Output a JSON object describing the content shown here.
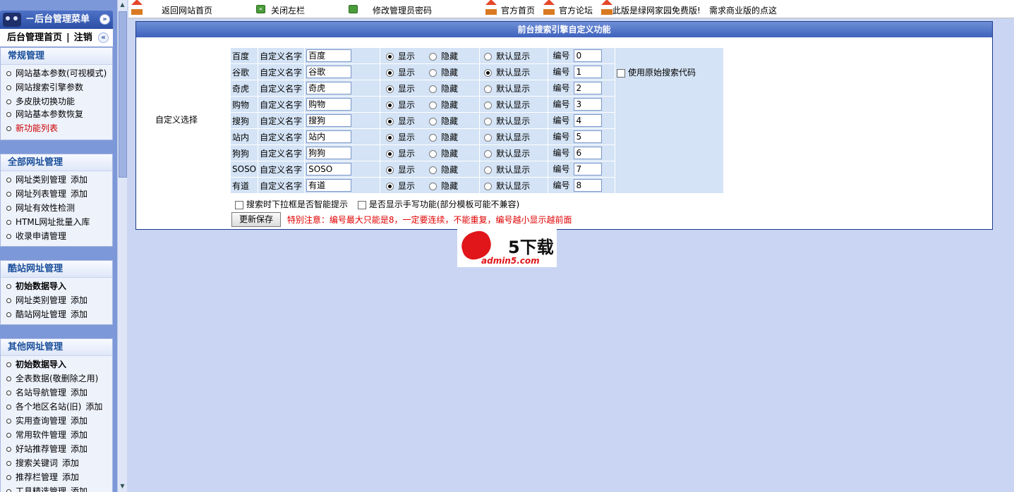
{
  "sidebar": {
    "header": "－后台管理菜单",
    "top_link": "后台管理首页",
    "top_sep": "|",
    "logout": "注销",
    "collapse_glyph": "«",
    "expand_glyph": "»",
    "sections": [
      {
        "title": "常规管理",
        "items": [
          {
            "label": "网站基本参数(可视模式)"
          },
          {
            "label": "网站搜索引擎参数"
          },
          {
            "label": "多皮肤切换功能"
          },
          {
            "label": "网站基本参数恢复"
          },
          {
            "label": "新功能列表"
          }
        ]
      },
      {
        "title": "全部网址管理",
        "items": [
          {
            "label": "网址类别管理",
            "add": "添加"
          },
          {
            "label": "网址列表管理",
            "add": "添加"
          },
          {
            "label": "网址有效性检测"
          },
          {
            "label": "HTML网址批量入库"
          },
          {
            "label": "收录申请管理"
          }
        ]
      },
      {
        "title": "酷站网址管理",
        "items": [
          {
            "label": "初始数据导入"
          },
          {
            "label": "网址类别管理",
            "add": "添加"
          },
          {
            "label": "酷站网址管理",
            "add": "添加"
          }
        ]
      },
      {
        "title": "其他网址管理",
        "items": [
          {
            "label": "初始数据导入"
          },
          {
            "label": "全表数据(敬删除之用)"
          },
          {
            "label": "名站导航管理",
            "add": "添加"
          },
          {
            "label": "各个地区名站(旧)",
            "add": "添加"
          },
          {
            "label": "实用查询管理",
            "add": "添加"
          },
          {
            "label": "常用软件管理",
            "add": "添加"
          },
          {
            "label": "好站推荐管理",
            "add": "添加"
          },
          {
            "label": "搜索关键词",
            "add": "添加"
          },
          {
            "label": "推荐栏管理",
            "add": "添加"
          },
          {
            "label": "工具精选管理",
            "add": "添加"
          }
        ]
      }
    ]
  },
  "topbar": {
    "home": "返回网站首页",
    "close_left": "关闭左栏",
    "change_pwd": "修改管理员密码",
    "official_home": "官方首页",
    "official_forum": "官方论坛",
    "free_note": "此版是绿网家园免费版!",
    "commercial": "需求商业版的点这"
  },
  "main": {
    "title": "前台搜索引擎自定义功能",
    "left_label": "自定义选择",
    "custom_name_label": "自定义名字",
    "show_label": "显示",
    "hide_label": "隐藏",
    "default_label": "默认显示",
    "number_label": "编号",
    "use_original_label": "使用原始搜索代码",
    "use_original_checked": false,
    "engines": [
      {
        "name": "百度",
        "custom": "百度",
        "visible": "显示",
        "default": false,
        "number": "0"
      },
      {
        "name": "谷歌",
        "custom": "谷歌",
        "visible": "显示",
        "default": true,
        "number": "1"
      },
      {
        "name": "奇虎",
        "custom": "奇虎",
        "visible": "显示",
        "default": false,
        "number": "2"
      },
      {
        "name": "购物",
        "custom": "购物",
        "visible": "显示",
        "default": false,
        "number": "3"
      },
      {
        "name": "搜狗",
        "custom": "搜狗",
        "visible": "显示",
        "default": false,
        "number": "4"
      },
      {
        "name": "站内",
        "custom": "站内",
        "visible": "显示",
        "default": false,
        "number": "5"
      },
      {
        "name": "狗狗",
        "custom": "狗狗",
        "visible": "显示",
        "default": false,
        "number": "6"
      },
      {
        "name": "SOSO",
        "custom": "SOSO",
        "visible": "显示",
        "default": false,
        "number": "7"
      },
      {
        "name": "有道",
        "custom": "有道",
        "visible": "显示",
        "default": false,
        "number": "8"
      }
    ],
    "smart_hint_label": "搜索时下拉框是否智能提示",
    "smart_hint_checked": false,
    "handwrite_label": "是否显示手写功能(部分模板可能不兼容)",
    "handwrite_checked": false,
    "save_button": "更新保存",
    "note": "特别注意：编号最大只能是8，一定要连续，不能重复，编号越小显示越前面"
  },
  "watermark": {
    "logo_text": "5下载",
    "url": "admin5.com"
  }
}
